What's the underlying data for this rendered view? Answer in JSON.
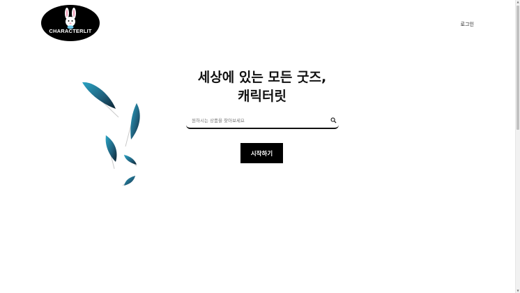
{
  "header": {
    "logo_text": "CHARACTERLIT",
    "login_label": "로그인"
  },
  "hero": {
    "headline_line1": "세상에 있는 모든 굿즈,",
    "headline_line2": "캐릭터릿"
  },
  "search": {
    "placeholder": "원하시는 상품을 찾아보세요",
    "value": ""
  },
  "start_button_label": "시작하기",
  "icons": {
    "logo_mascot": "rabbit-icon",
    "search": "search-icon",
    "decoration": "feather-icon"
  },
  "colors": {
    "background": "#ffffff",
    "primary": "#000000",
    "feather": "#1f6f8b"
  }
}
